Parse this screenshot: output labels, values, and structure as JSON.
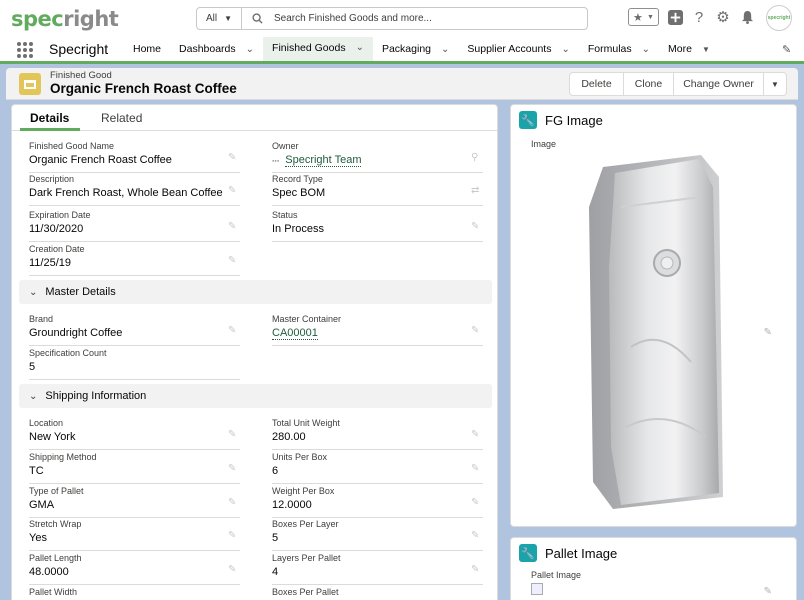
{
  "brand": {
    "logo_part1": "spec",
    "logo_part2": "right",
    "avatar_text": "specright"
  },
  "search": {
    "scope": "All",
    "placeholder": "Search Finished Goods and more..."
  },
  "nav": {
    "app_name": "Specright",
    "tabs": [
      {
        "label": "Home",
        "dropdown": false
      },
      {
        "label": "Dashboards",
        "dropdown": true
      },
      {
        "label": "Finished Goods",
        "dropdown": true,
        "active": true
      },
      {
        "label": "Packaging",
        "dropdown": true
      },
      {
        "label": "Supplier Accounts",
        "dropdown": true
      },
      {
        "label": "Formulas",
        "dropdown": true
      },
      {
        "label": "More",
        "dropdown": true
      }
    ]
  },
  "record": {
    "object_label": "Finished Good",
    "title": "Organic French Roast Coffee",
    "actions": [
      "Delete",
      "Clone",
      "Change Owner"
    ]
  },
  "detail_tabs": [
    "Details",
    "Related"
  ],
  "fields": {
    "finished_good_name": {
      "label": "Finished Good Name",
      "value": "Organic French Roast Coffee"
    },
    "owner": {
      "label": "Owner",
      "value": "Specright Team"
    },
    "description": {
      "label": "Description",
      "value": "Dark French Roast, Whole Bean Coffee"
    },
    "record_type": {
      "label": "Record Type",
      "value": "Spec BOM"
    },
    "expiration_date": {
      "label": "Expiration Date",
      "value": "11/30/2020"
    },
    "status": {
      "label": "Status",
      "value": "In Process"
    },
    "creation_date": {
      "label": "Creation Date",
      "value": "11/25/19"
    }
  },
  "sections": {
    "master": {
      "title": "Master Details",
      "brand": {
        "label": "Brand",
        "value": "Groundright Coffee"
      },
      "master_container": {
        "label": "Master Container",
        "value": "CA00001"
      },
      "spec_count": {
        "label": "Specification Count",
        "value": "5"
      }
    },
    "shipping": {
      "title": "Shipping Information",
      "location": {
        "label": "Location",
        "value": "New York"
      },
      "total_unit_weight": {
        "label": "Total Unit Weight",
        "value": "280.00"
      },
      "shipping_method": {
        "label": "Shipping Method",
        "value": "TC"
      },
      "units_per_box": {
        "label": "Units Per Box",
        "value": "6"
      },
      "type_of_pallet": {
        "label": "Type of Pallet",
        "value": "GMA"
      },
      "weight_per_box": {
        "label": "Weight Per Box",
        "value": "12.0000"
      },
      "stretch_wrap": {
        "label": "Stretch Wrap",
        "value": "Yes"
      },
      "boxes_per_layer": {
        "label": "Boxes Per Layer",
        "value": "5"
      },
      "pallet_length": {
        "label": "Pallet Length",
        "value": "48.0000"
      },
      "layers_per_pallet": {
        "label": "Layers Per Pallet",
        "value": "4"
      },
      "pallet_width": {
        "label": "Pallet Width",
        "value": ""
      },
      "boxes_per_pallet": {
        "label": "Boxes Per Pallet",
        "value": ""
      }
    }
  },
  "fg_image": {
    "title": "FG Image",
    "label": "Image"
  },
  "pallet_image": {
    "title": "Pallet Image",
    "label": "Pallet Image"
  },
  "colors": {
    "brand_green": "#62ab5e",
    "accent_teal": "#1aa3a8",
    "header_icon": "#e3c65a"
  }
}
